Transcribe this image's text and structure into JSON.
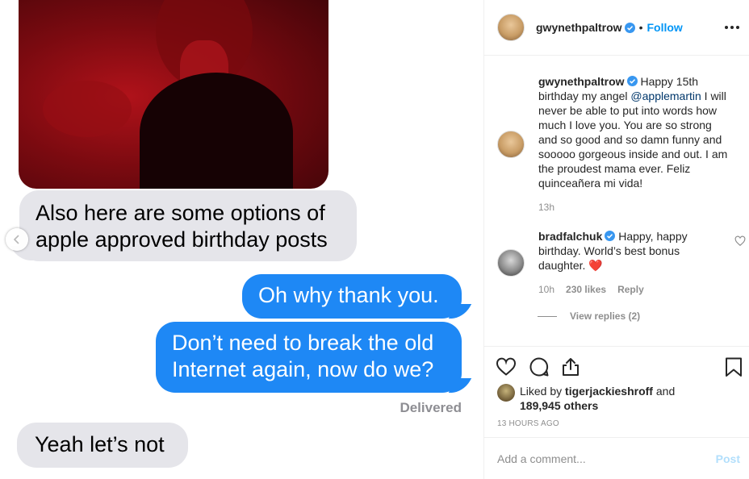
{
  "messages": {
    "incoming_1": "Also here are some options of apple approved birthday posts",
    "outgoing_1": "Oh why thank you.",
    "outgoing_2": "Don’t need to break the old Internet again, now do we?",
    "status": "Delivered",
    "incoming_2": "Yeah let’s not"
  },
  "header": {
    "username": "gwynethpaltrow",
    "separator": "•",
    "follow_label": "Follow",
    "verified_icon": "verified-badge-icon",
    "more_icon": "more-options-icon"
  },
  "caption": {
    "username": "gwynethpaltrow",
    "text_before": "Happy 15th birthday my angel ",
    "mention": "@applemartin",
    "text_after": " I will never be able to put into words how much I love you. You are so strong and so good and so damn funny and sooooo gorgeous inside and out. I am the proudest mama ever. Feliz quinceañera mi vida!",
    "age": "13h"
  },
  "reply": {
    "username": "bradfalchuk",
    "text": "Happy, happy birthday. World’s best bonus daughter.",
    "emoji": "❤️",
    "age": "10h",
    "likes": "230 likes",
    "reply_label": "Reply",
    "view_replies": "View replies (2)"
  },
  "likes": {
    "prefix": "Liked by ",
    "user": "tigerjackieshroff",
    "middle": " and",
    "count": "189,945 others"
  },
  "timestamp": "13 HOURS AGO",
  "add_comment": {
    "placeholder": "Add a comment...",
    "post_label": "Post"
  },
  "colors": {
    "ios_blue": "#1e88f5",
    "ios_grey": "#e5e5ea",
    "ig_blue": "#0095f6",
    "heart_red": "#ed4956"
  }
}
